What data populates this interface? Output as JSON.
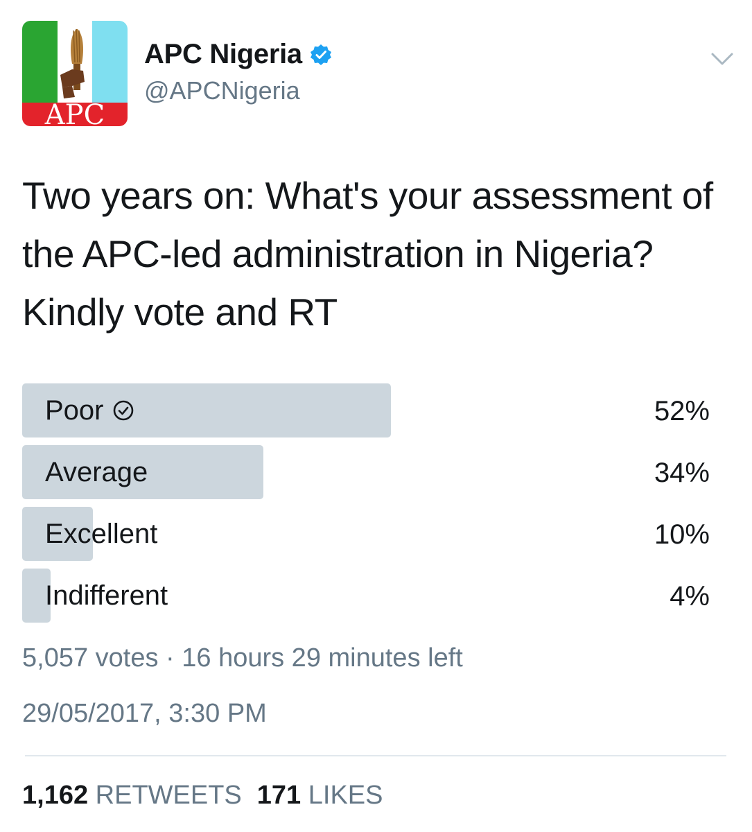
{
  "account": {
    "avatar_text": "APC",
    "name": "APC Nigeria",
    "handle": "@APCNigeria",
    "verified": true
  },
  "tweet": {
    "text": "Two years on: What's your assessment of the APC-led administration in Nigeria? Kindly vote and RT"
  },
  "poll": {
    "options": [
      {
        "label": "Poor",
        "percent_text": "52%",
        "percent": 52,
        "winner": true
      },
      {
        "label": "Average",
        "percent_text": "34%",
        "percent": 34,
        "winner": false
      },
      {
        "label": "Excellent",
        "percent_text": "10%",
        "percent": 10,
        "winner": false
      },
      {
        "label": "Indifferent",
        "percent_text": "4%",
        "percent": 4,
        "winner": false
      }
    ],
    "summary": "5,057 votes · 16 hours 29 minutes left"
  },
  "timestamp": "29/05/2017, 3:30 PM",
  "stats": {
    "retweets_count": "1,162",
    "retweets_label": "RETWEETS",
    "likes_count": "171",
    "likes_label": "LIKES"
  },
  "colors": {
    "bar": "#ccd6dd",
    "secondary_text": "#657786",
    "verified_blue": "#1da1f2",
    "flag_green": "#2aa532",
    "flag_cyan": "#7fdff0",
    "logo_red": "#e3232b"
  },
  "icons": {
    "verified": "verified-badge-icon",
    "more": "chevron-down-icon",
    "winner": "check-circle-icon"
  }
}
